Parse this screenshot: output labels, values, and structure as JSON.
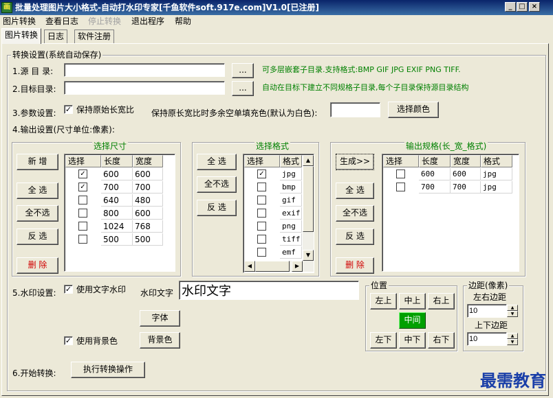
{
  "window": {
    "title": "批量处理图片大小格式-自动打水印专家[千鱼软件soft.917e.com]V1.0[已注册]",
    "icon_glyph": "画",
    "min": "_",
    "max": "□",
    "close": "×"
  },
  "menu": [
    "图片转换",
    "查看日志",
    "停止转换",
    "退出程序",
    "帮助"
  ],
  "tabs": [
    "图片转换",
    "日志",
    "软件注册"
  ],
  "settings": {
    "legend": "转换设置(系统自动保存)",
    "source_label": "1.源 目 录:",
    "source_value": "",
    "browse": "...",
    "source_hint": "可多层嵌套子目录.支持格式:BMP GIF JPG EXIF PNG TIFF.",
    "target_label": "2.目标目录:",
    "target_value": "",
    "target_hint": "自动在目标下建立不同规格子目录,每个子目录保持源目录结构",
    "param_label": "3.参数设置:",
    "keep_ratio_label": "保持原始长宽比",
    "keep_ratio_checked": true,
    "fill_label": "保持原长宽比时多余空单填充色(默认为白色):",
    "fill_value": "",
    "select_color": "选择颜色",
    "output_label": "4.输出设置(尺寸单位:像素):"
  },
  "sizes": {
    "legend": "选择尺寸",
    "buttons": {
      "add": "新 增",
      "select_all": "全 选",
      "select_none": "全不选",
      "invert": "反 选",
      "delete": "删 除"
    },
    "headers": [
      "选择",
      "长度",
      "宽度"
    ],
    "rows": [
      {
        "checked": true,
        "w": "600",
        "h": "600"
      },
      {
        "checked": true,
        "w": "700",
        "h": "700"
      },
      {
        "checked": false,
        "w": "640",
        "h": "480"
      },
      {
        "checked": false,
        "w": "800",
        "h": "600"
      },
      {
        "checked": false,
        "w": "1024",
        "h": "768"
      },
      {
        "checked": false,
        "w": "500",
        "h": "500"
      }
    ]
  },
  "formats": {
    "legend": "选择格式",
    "buttons": {
      "select_all": "全 选",
      "select_none": "全不选",
      "invert": "反 选"
    },
    "headers": [
      "选择",
      "格式"
    ],
    "rows": [
      {
        "checked": true,
        "fmt": "jpg"
      },
      {
        "checked": false,
        "fmt": "bmp"
      },
      {
        "checked": false,
        "fmt": "gif"
      },
      {
        "checked": false,
        "fmt": "exif"
      },
      {
        "checked": false,
        "fmt": "png"
      },
      {
        "checked": false,
        "fmt": "tiff"
      },
      {
        "checked": false,
        "fmt": "emf"
      }
    ]
  },
  "output": {
    "legend": "输出规格(长_宽_格式)",
    "buttons": {
      "generate": "生成>>",
      "select_all": "全 选",
      "select_none": "全不选",
      "invert": "反 选",
      "delete": "删 除"
    },
    "headers": [
      "选择",
      "长度",
      "宽度",
      "格式"
    ],
    "rows": [
      {
        "checked": false,
        "w": "600",
        "h": "600",
        "fmt": "jpg"
      },
      {
        "checked": false,
        "w": "700",
        "h": "700",
        "fmt": "jpg"
      }
    ]
  },
  "watermark": {
    "label": "5.水印设置:",
    "use_text_label": "使用文字水印",
    "use_text_checked": true,
    "text_label": "水印文字",
    "text_value": "水印文字",
    "font_btn": "字体",
    "use_bg_label": "使用背景色",
    "use_bg_checked": true,
    "bg_btn": "背景色"
  },
  "position": {
    "legend": "位置",
    "buttons": [
      "左上",
      "中上",
      "右上",
      "中间",
      "左下",
      "中下",
      "右下"
    ]
  },
  "margin": {
    "legend": "边距(像素)",
    "lr_label": "左右边距",
    "lr_value": "10",
    "tb_label": "上下边距",
    "tb_value": "10"
  },
  "start": {
    "label": "6.开始转换:",
    "button": "执行转换操作"
  },
  "brand": "最需教育",
  "colors": {
    "accent_green": "#008000",
    "danger_red": "#d00000",
    "center_btn": "#00a000",
    "titlebar": "#0a246a"
  }
}
